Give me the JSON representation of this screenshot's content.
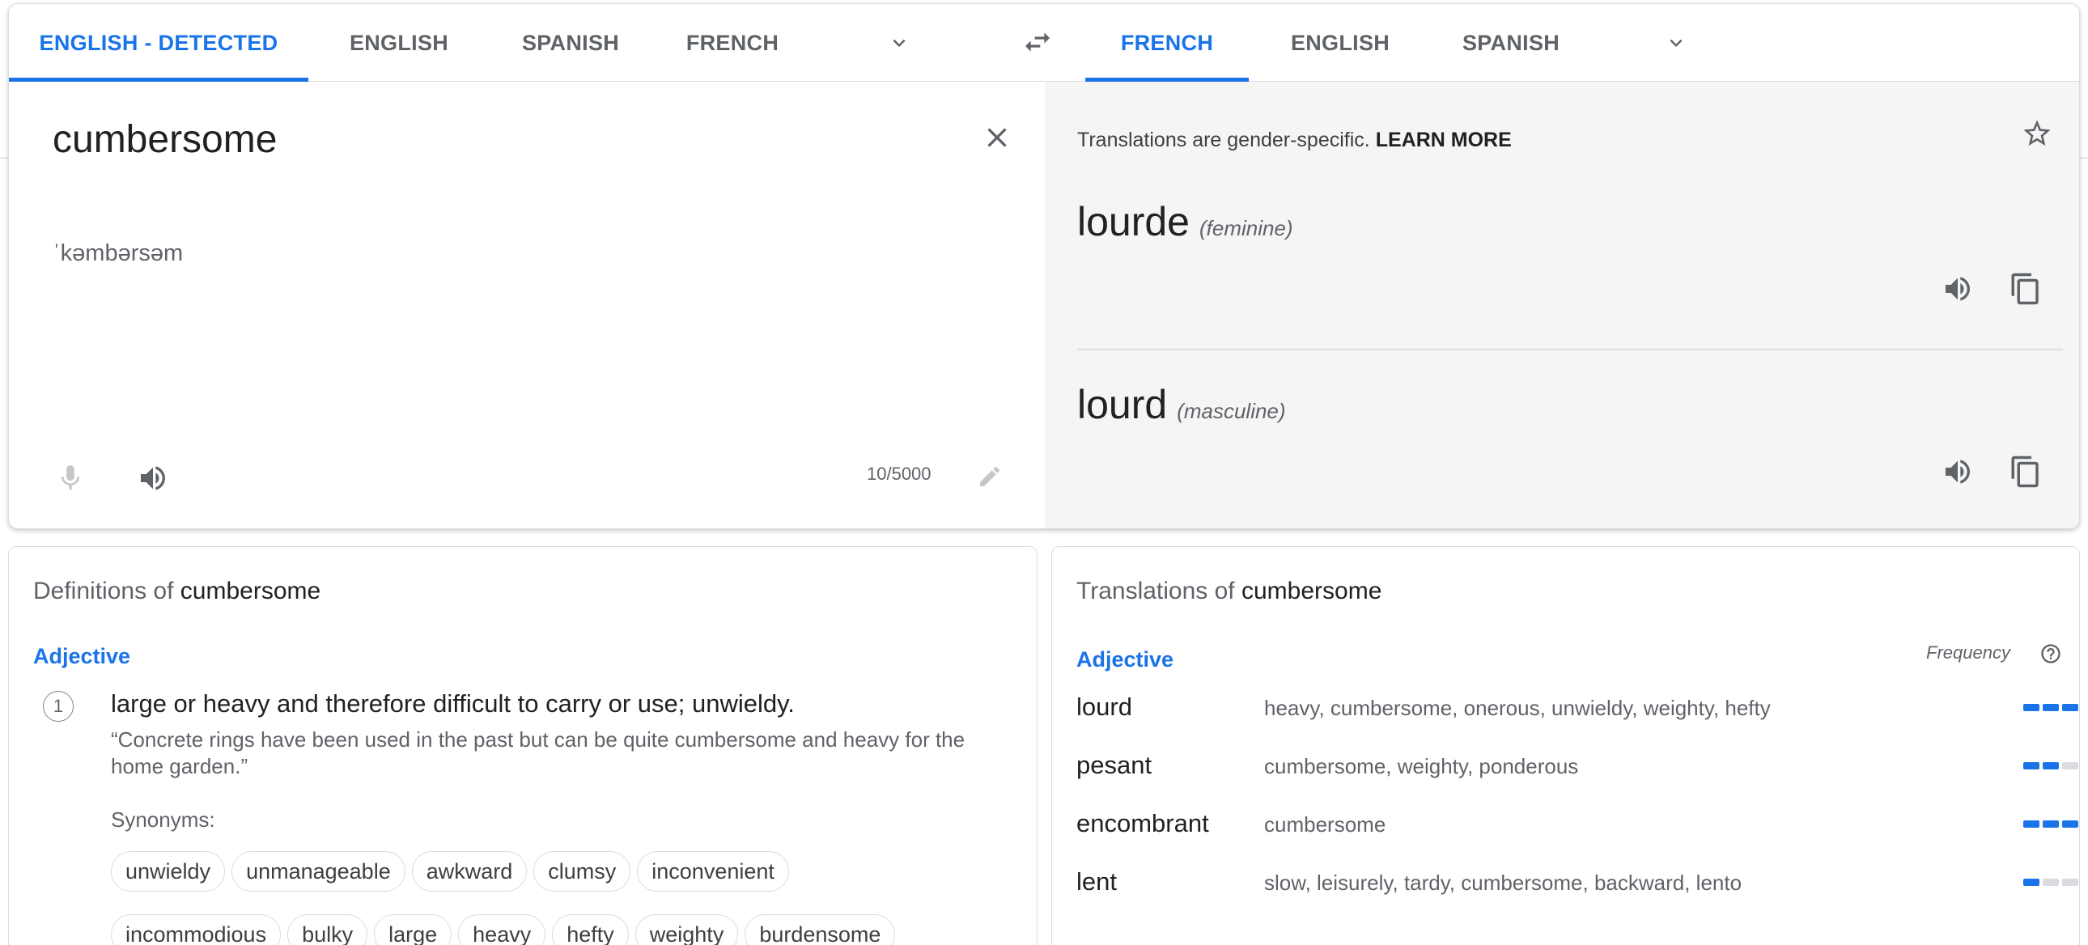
{
  "source_tabs": [
    {
      "label": "ENGLISH - DETECTED",
      "active": true
    },
    {
      "label": "ENGLISH",
      "active": false
    },
    {
      "label": "SPANISH",
      "active": false
    },
    {
      "label": "FRENCH",
      "active": false
    }
  ],
  "target_tabs": [
    {
      "label": "FRENCH",
      "active": true
    },
    {
      "label": "ENGLISH",
      "active": false
    },
    {
      "label": "SPANISH",
      "active": false
    }
  ],
  "source": {
    "text": "cumbersome",
    "phonetic": "ˈkəmbərsəm",
    "char_count": "10/5000"
  },
  "target": {
    "notice_text": "Translations are gender-specific.",
    "learn_more": "LEARN MORE",
    "results": [
      {
        "word": "lourde",
        "gender": "(feminine)"
      },
      {
        "word": "lourd",
        "gender": "(masculine)"
      }
    ]
  },
  "definitions": {
    "title_prefix": "Definitions of",
    "term": "cumbersome",
    "pos": "Adjective",
    "number": "1",
    "definition": "large or heavy and therefore difficult to carry or use; unwieldy.",
    "example": "“Concrete rings have been used in the past but can be quite cumbersome and heavy for the home garden.”",
    "synonyms_label": "Synonyms:",
    "synonyms": [
      "unwieldy",
      "unmanageable",
      "awkward",
      "clumsy",
      "inconvenient",
      "incommodious",
      "bulky",
      "large",
      "heavy",
      "hefty",
      "weighty",
      "burdensome"
    ]
  },
  "translations": {
    "title_prefix": "Translations of",
    "term": "cumbersome",
    "pos": "Adjective",
    "frequency_label": "Frequency",
    "rows": [
      {
        "word": "lourd",
        "alts": "heavy, cumbersome, onerous, unwieldy, weighty, hefty",
        "frequency": 3
      },
      {
        "word": "pesant",
        "alts": "cumbersome, weighty, ponderous",
        "frequency": 2
      },
      {
        "word": "encombrant",
        "alts": "cumbersome",
        "frequency": 3
      },
      {
        "word": "lent",
        "alts": "slow, leisurely, tardy, cumbersome, backward, lento",
        "frequency": 1
      }
    ]
  },
  "icons": {
    "more_languages": "chevron-down-icon",
    "swap": "swap-languages-icon",
    "clear": "close-icon",
    "mic": "microphone-icon",
    "listen": "speaker-icon",
    "edit": "pencil-icon",
    "save": "star-icon",
    "copy": "copy-icon",
    "help": "help-circle-icon"
  },
  "colors": {
    "accent": "#1a73e8",
    "target_panel_bg": "#f5f5f5",
    "muted_text": "#5f6368"
  }
}
